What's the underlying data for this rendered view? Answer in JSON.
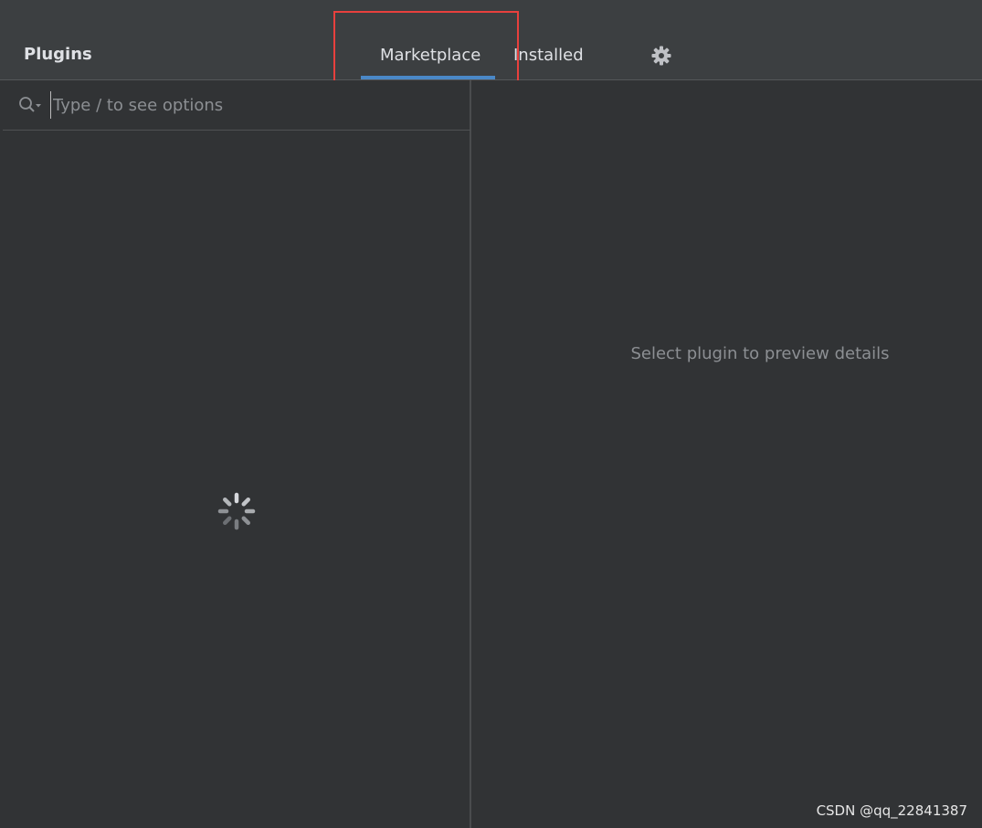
{
  "header": {
    "title": "Plugins",
    "tabs": [
      {
        "label": "Marketplace",
        "selected": true
      },
      {
        "label": "Installed",
        "selected": false
      }
    ],
    "settings_icon": "gear-icon"
  },
  "search": {
    "placeholder": "Type / to see options",
    "value": "",
    "icon": "search-icon"
  },
  "list": {
    "loading_icon": "spinner-icon"
  },
  "details": {
    "empty_message": "Select plugin to preview details"
  },
  "watermark": "CSDN @qq_22841387",
  "colors": {
    "accent": "#4a88c7",
    "highlight": "#e8403d",
    "background": "#313335",
    "header": "#3c3f41"
  }
}
